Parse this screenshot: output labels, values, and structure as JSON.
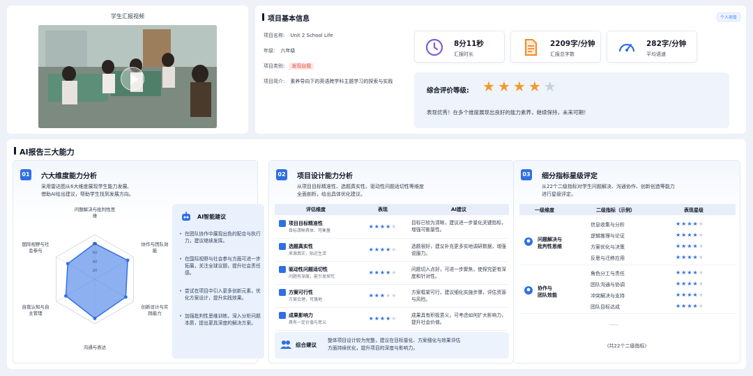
{
  "video": {
    "title": "学生汇报视频"
  },
  "project": {
    "section_title": "项目基本信息",
    "personal_tag": "个人项目",
    "name_label": "项目名称:",
    "name_value": "Unit 2 School Life",
    "grade_label": "年级:",
    "grade_value": "六年级",
    "category_label": "项目类别:",
    "category_value": "发现自我",
    "intro_label": "项目简介:",
    "intro_value": "素养导向下的英语跨学科主题学习的探索与实践"
  },
  "stats": [
    {
      "value": "8分11秒",
      "label": "汇报时长",
      "icon": "clock-icon",
      "color": "#7c5cd6"
    },
    {
      "value": "2209字/分钟",
      "label": "汇报总字数",
      "icon": "document-icon",
      "color": "#f0892b"
    },
    {
      "value": "282字/分钟",
      "label": "平均语速",
      "icon": "speedometer-icon",
      "color": "#2f6fe4"
    }
  ],
  "rating": {
    "label": "综合评价等级:",
    "score": 4,
    "max": 5,
    "star_color": "#f39a2b",
    "text": "表现优秀！在多个维度展现出良好的能力素养，继续保持，未来可期！"
  },
  "ai": {
    "section_title": "AI报告三大能力",
    "panel1": {
      "num": "01",
      "title": "六大维度能力分析",
      "desc1": "采用雷达图从6大维度展现学生能力发展,",
      "desc2": "借助AI给出建议，帮助学生找到发展方向。",
      "radar_labels": [
        "问题解决与批判性思维",
        "协作与团队效能",
        "创新设计与实践能力",
        "沟通与表达",
        "自我认知与自主管理",
        "国际视野与社会参与"
      ],
      "advice_title": "AI智能建议",
      "advice": [
        "在团队协作中展现出色的配合与执行力，建议继续发挥。",
        "在国际视野与社会参与方面可进一步拓展，关注全球议题，提升社会责任感。",
        "尝试在项目中引入更多创新元素，优化方案设计，提升实践效果。",
        "加强批判性思维训练，深入分析问题本质，提出更具深度的解决方案。"
      ]
    },
    "panel2": {
      "num": "02",
      "title": "项目设计能力分析",
      "desc1": "从项目目标精准性、选题真实性、驱动性问题适切性等维度",
      "desc2": "全面剖析，给出具体优化建议。",
      "headers": [
        "评估维度",
        "表现",
        "AI建议"
      ],
      "rows": [
        {
          "name": "项目目标精准性",
          "sub": "目标清晰具体、可衡量",
          "stars": 4,
          "advice": "目标已较为清晰，建议进一步量化关键指标，增强可衡量性。"
        },
        {
          "name": "选题真实性",
          "sub": "来源真实，贴近生活",
          "stars": 4,
          "advice": "选题很好，建议补充更多实地调研数据，增强说服力。"
        },
        {
          "name": "驱动性问题适切性",
          "sub": "问题有深度，能引发探究",
          "stars": 4,
          "advice": "问题切入点好，可进一步聚焦，使探究更有深度和针对性。"
        },
        {
          "name": "方案可行性",
          "sub": "方案合理，可落地",
          "stars": 3,
          "advice": "方案框架可行，建议细化实施步骤，评估资源与风险。"
        },
        {
          "name": "成果影响力",
          "sub": "具有一定价值与意义",
          "stars": 4,
          "advice": "成果具有积极意义，可考虑如何扩大影响力，提升社会价值。"
        }
      ],
      "summary_label": "综合建议",
      "summary1": "整体项目设计较为完整，建议在目标量化、方案细化与效果评估",
      "summary2": "方面持续优化，提升项目的深度与影响力。"
    },
    "panel3": {
      "num": "03",
      "title": "细分指标星级评定",
      "desc1": "从22个二级指标对学生问题解决、沟通协作、创新创造等能力",
      "desc2": "进行星级评定。",
      "headers": [
        "一级维度",
        "二级指标（示例）",
        "表现星级"
      ],
      "groups": [
        {
          "name1": "问题解决与",
          "name2": "批判性思维",
          "items": [
            {
              "name": "信息收集与分析",
              "stars": 4
            },
            {
              "name": "逻辑推理与论证",
              "stars": 4
            },
            {
              "name": "方案优化与决策",
              "stars": 4
            },
            {
              "name": "反思与迁移应用",
              "stars": 4
            }
          ]
        },
        {
          "name1": "协作与",
          "name2": "团队效能",
          "items": [
            {
              "name": "角色分工与责任",
              "stars": 4
            },
            {
              "name": "团队沟通与协调",
              "stars": 4
            },
            {
              "name": "冲突解决与支持",
              "stars": 4
            },
            {
              "name": "团队目标达成",
              "stars": 4
            }
          ]
        }
      ],
      "ellipsis": "......",
      "footer": "(共22个二级指标)"
    }
  },
  "chart_data": {
    "type": "radar",
    "categories": [
      "问题解决与批判性思维",
      "协作与团队效能",
      "创新设计与实践能力",
      "沟通与表达",
      "自我认知与自主管理",
      "国际视野与社会参与"
    ],
    "values": [
      80,
      85,
      80,
      88,
      75,
      70
    ],
    "rlim": [
      0,
      100
    ],
    "ticks": [
      20,
      40,
      60,
      80
    ]
  }
}
